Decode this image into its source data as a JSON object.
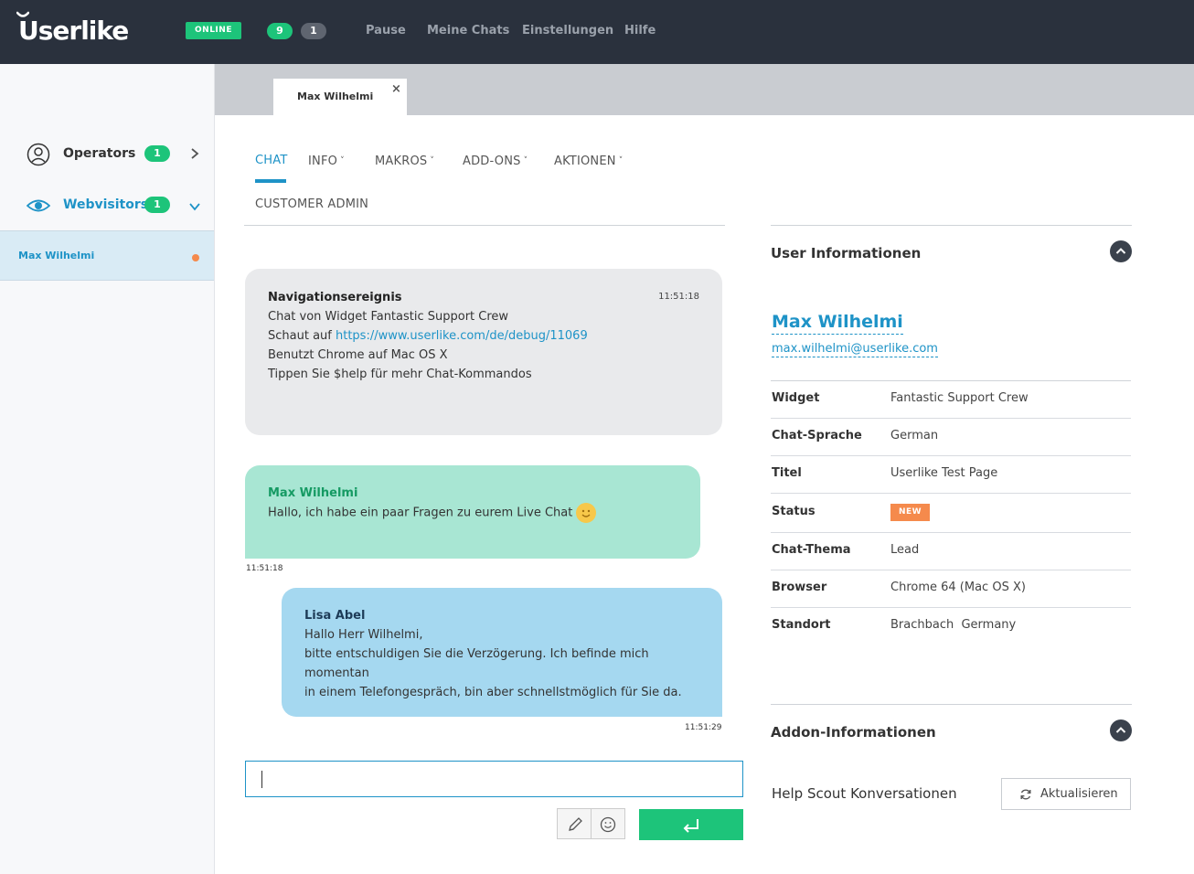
{
  "header": {
    "logo": "Userlike",
    "status": "ONLINE",
    "counts": [
      "9",
      "1"
    ],
    "nav": [
      "Pause",
      "Meine Chats",
      "Einstellungen",
      "Hilfe"
    ]
  },
  "sidebar": {
    "operators": {
      "label": "Operators",
      "count": "1"
    },
    "webvisitors": {
      "label": "Webvisitors",
      "count": "1"
    },
    "visitor": "Max Wilhelmi"
  },
  "tab": {
    "title": "Max Wilhelmi",
    "close": "×"
  },
  "subnav": {
    "items": [
      "CHAT",
      "INFO",
      "MAKROS",
      "ADD-ONS",
      "AKTIONEN"
    ],
    "second_row": "CUSTOMER ADMIN"
  },
  "messages": {
    "system": {
      "title": "Navigationsereignis",
      "time": "11:51:18",
      "line1": "Chat von Widget Fantastic Support Crew",
      "line2_prefix": "Schaut auf ",
      "line2_link": "https://www.userlike.com/de/debug/11069",
      "line3": "Benutzt Chrome auf Mac OS X",
      "line4": "Tippen Sie $help für mehr Chat-Kommandos"
    },
    "visitor": {
      "author": "Max Wilhelmi",
      "text": "Hallo, ich habe ein paar Fragen zu eurem Live Chat",
      "time": "11:51:18"
    },
    "operator": {
      "author": "Lisa Abel",
      "line1": "Hallo Herr Wilhelmi,",
      "line2": "bitte entschuldigen Sie die Verzögerung. Ich befinde mich momentan",
      "line3": "in einem Telefongespräch, bin aber schnellstmöglich für Sie da.",
      "time": "11:51:29"
    }
  },
  "user_info": {
    "heading": "User Informationen",
    "name": "Max Wilhelmi",
    "email": "max.wilhelmi@userlike.com",
    "rows": [
      {
        "key": "Widget",
        "value": "Fantastic Support Crew"
      },
      {
        "key": "Chat-Sprache",
        "value": "German"
      },
      {
        "key": "Titel",
        "value": "Userlike Test Page"
      },
      {
        "key": "Status",
        "value": "NEW"
      },
      {
        "key": "Chat-Thema",
        "value": "Lead"
      },
      {
        "key": "Browser",
        "value": "Chrome 64 (Mac OS X)"
      },
      {
        "key": "Standort",
        "value": "Brachbach  Germany"
      }
    ]
  },
  "addon_info": {
    "heading": "Addon-Informationen",
    "helpscout": "Help Scout Konversationen",
    "refresh": "Aktualisieren"
  },
  "colors": {
    "topbar": "#2a313d",
    "accent_blue": "#1e93c7",
    "green": "#1dc47a",
    "orange": "#f58a4c"
  }
}
